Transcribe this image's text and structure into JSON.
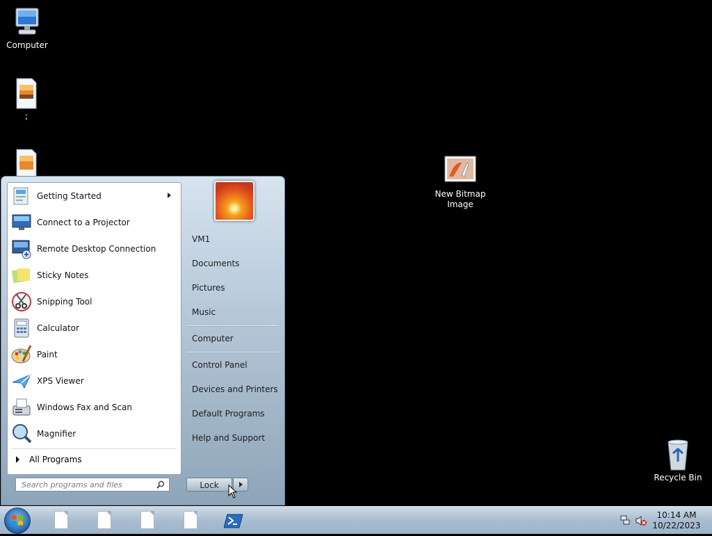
{
  "desktop": {
    "icons": [
      {
        "label": "Computer"
      },
      {
        "label": ";"
      },
      {
        "label": ""
      },
      {
        "label": "New Bitmap Image"
      },
      {
        "label": "Recycle Bin"
      }
    ]
  },
  "start_menu": {
    "programs": [
      {
        "label": "Getting Started",
        "icon": "getting-started-icon",
        "has_submenu": true
      },
      {
        "label": "Connect to a Projector",
        "icon": "projector-icon"
      },
      {
        "label": "Remote Desktop Connection",
        "icon": "remote-desktop-icon"
      },
      {
        "label": "Sticky Notes",
        "icon": "sticky-notes-icon"
      },
      {
        "label": "Snipping Tool",
        "icon": "scissors-icon"
      },
      {
        "label": "Calculator",
        "icon": "calculator-icon"
      },
      {
        "label": "Paint",
        "icon": "paint-palette-icon"
      },
      {
        "label": "XPS Viewer",
        "icon": "xps-viewer-icon"
      },
      {
        "label": "Windows Fax and Scan",
        "icon": "fax-icon"
      },
      {
        "label": "Magnifier",
        "icon": "magnifier-icon"
      }
    ],
    "all_programs": "All Programs",
    "search_placeholder": "Search programs and files",
    "right_links": [
      {
        "label": "VM1"
      },
      {
        "label": "Documents"
      },
      {
        "label": "Pictures"
      },
      {
        "label": "Music"
      },
      {
        "label": "Computer"
      },
      {
        "label": "Control Panel"
      },
      {
        "label": "Devices and Printers"
      },
      {
        "label": "Default Programs"
      },
      {
        "label": "Help and Support"
      }
    ],
    "lock_label": "Lock"
  },
  "taskbar": {
    "time": "10:14 AM",
    "date": "10/22/2023",
    "pinned": [
      {
        "icon": "document-icon"
      },
      {
        "icon": "document-icon"
      },
      {
        "icon": "document-icon"
      },
      {
        "icon": "document-icon"
      },
      {
        "icon": "powershell-icon"
      }
    ]
  },
  "colors": {
    "desktop_bg": "#000000",
    "start_menu_bg": "#b7c9d9",
    "taskbar_bg": "#a8bdd0"
  }
}
